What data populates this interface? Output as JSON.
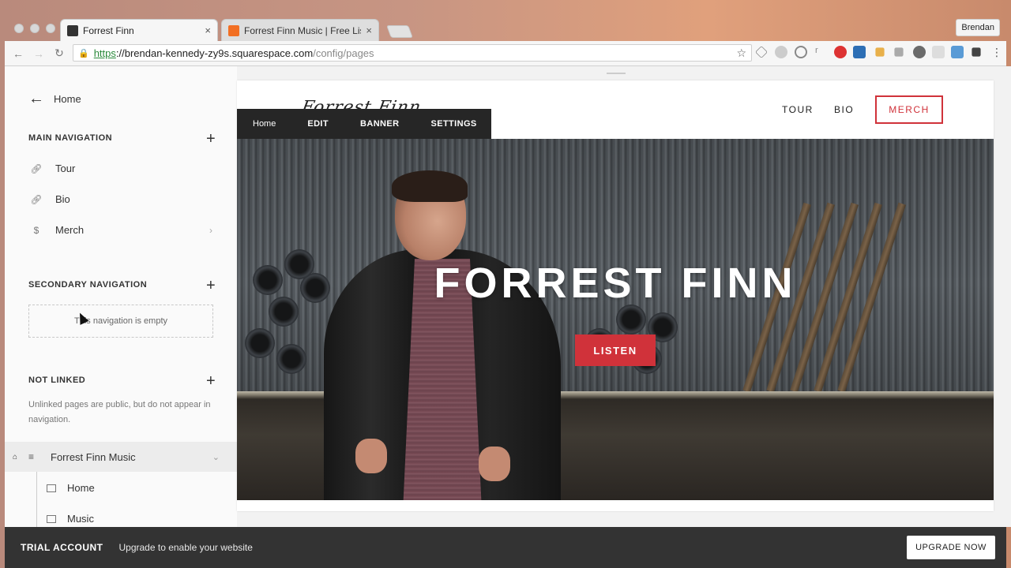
{
  "browser": {
    "tabs": [
      {
        "title": "Forrest Finn",
        "close": "×"
      },
      {
        "title": "Forrest Finn Music | Free Liste",
        "close": "×"
      }
    ],
    "profile": "Brendan",
    "url": {
      "scheme": "https",
      "host": "://brendan-kennedy-zy9s.squarespace.com",
      "path": "/config/pages"
    },
    "nav": {
      "back": "←",
      "forward": "→",
      "reload": "↻",
      "star": "☆"
    }
  },
  "sidebar": {
    "back_label": "Home",
    "main_nav": {
      "heading": "MAIN NAVIGATION",
      "items": [
        {
          "label": "Tour",
          "icon": "link-icon"
        },
        {
          "label": "Bio",
          "icon": "link-icon"
        },
        {
          "label": "Merch",
          "icon": "dollar-icon"
        }
      ]
    },
    "secondary_nav": {
      "heading": "SECONDARY NAVIGATION",
      "empty_text": "This navigation is empty"
    },
    "not_linked": {
      "heading": "NOT LINKED",
      "description": "Unlinked pages are public, but do not appear in navigation."
    },
    "site": {
      "label": "Forrest Finn Music",
      "pages": [
        "Home",
        "Music"
      ]
    }
  },
  "preview": {
    "logo": "Forrest Finn",
    "nav": [
      "TOUR",
      "BIO"
    ],
    "merch": "MERCH",
    "edit_bar": {
      "page": "Home",
      "edit": "EDIT",
      "banner": "BANNER",
      "settings": "SETTINGS"
    },
    "hero_title": "FORREST FINN",
    "listen": "LISTEN"
  },
  "trial": {
    "label": "TRIAL ACCOUNT",
    "message": "Upgrade to enable your website",
    "button": "UPGRADE NOW"
  },
  "colors": {
    "accent": "#d0323a",
    "trial_bar": "#333333"
  }
}
